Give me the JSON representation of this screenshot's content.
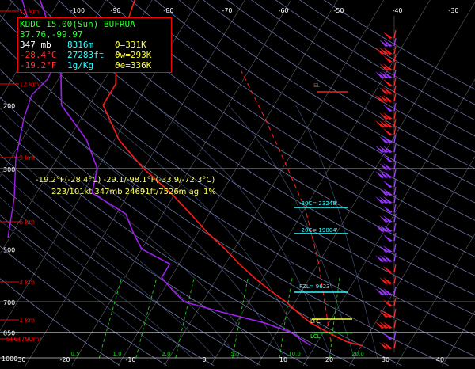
{
  "colors": {
    "background": "#000000",
    "isobar": "#ffffff",
    "isotherm": "#aab0c8",
    "dry_adiabat": "#7e88c4",
    "moist_adiabat": "#5a6fa0",
    "mixing_ratio": "#22cc22",
    "temperature": "#ff1a1a",
    "dewpoint": "#a020f0",
    "parcel": "#ff1a1a",
    "wind_barb_red": "#ff1a1a",
    "wind_barb_purple": "#9933ff",
    "height_label": "#ff0000",
    "info_title": "#33ff33",
    "info_white": "#ffffff",
    "info_cyan": "#33ffff",
    "info_yellow": "#ffff33",
    "info_red": "#ff3333",
    "cursor_text": "#ffff66",
    "level_marker": "#33ffff",
    "lfc_marker": "#ffff33",
    "lcl_marker": "#33ff33"
  },
  "info_box": {
    "title": "KDDC 15.00(Sun) BUFRUA",
    "latlon": "37.76,-99.97",
    "pressure": "347 mb",
    "height_m": "8316m",
    "theta": "ϑ=331K",
    "temp": "-28.4°C",
    "height_ft": "27283ft",
    "theta_w": "ϑw=293K",
    "dewpoint": "-19.2°F",
    "mixing": "1g/Kg",
    "theta_e": "ϑe=336K"
  },
  "cursor_readout": {
    "line1": "-19.2°F(-28.4°C) -29.1/-98.1°F(-33.9/-72.3°C)",
    "line2": "223/101kt  347mb  24691ft/7526m agl   1%"
  },
  "chart_data": {
    "type": "skew-t",
    "temperature_axis_labels": [
      "-100",
      "-90",
      "-80",
      "-70",
      "-60",
      "-50",
      "-40",
      "-30"
    ],
    "bottom_axis_labels": [
      "-30",
      "-20",
      "-10",
      "0",
      "10",
      "20",
      "30",
      "40"
    ],
    "pressure_labels": [
      "200",
      "300",
      "500",
      "700",
      "850",
      "1000"
    ],
    "height_labels": [
      "15 km",
      "12 km",
      "9 km",
      "6 km",
      "3 km",
      "1 km",
      "SFC(790m)"
    ],
    "mixing_ratio_labels": [
      "0.5",
      "1.0",
      "2.0",
      "5.0",
      "10.0",
      "20.0"
    ],
    "levels": [
      {
        "label": "EL"
      },
      {
        "label": "-30C= 23248'"
      },
      {
        "label": "-20C= 19004'"
      },
      {
        "label": "FZL= 9623'"
      },
      {
        "label": "LFC"
      },
      {
        "label": "LCL"
      }
    ],
    "temperature_profile_c": [
      {
        "p": 925,
        "t": 30
      },
      {
        "p": 900,
        "t": 26
      },
      {
        "p": 850,
        "t": 21
      },
      {
        "p": 800,
        "t": 16
      },
      {
        "p": 750,
        "t": 12
      },
      {
        "p": 700,
        "t": 8
      },
      {
        "p": 650,
        "t": 3
      },
      {
        "p": 600,
        "t": -2
      },
      {
        "p": 550,
        "t": -7
      },
      {
        "p": 500,
        "t": -12
      },
      {
        "p": 450,
        "t": -18
      },
      {
        "p": 400,
        "t": -24
      },
      {
        "p": 350,
        "t": -31
      },
      {
        "p": 300,
        "t": -40
      },
      {
        "p": 250,
        "t": -49
      },
      {
        "p": 200,
        "t": -57
      },
      {
        "p": 175,
        "t": -57
      },
      {
        "p": 150,
        "t": -60
      },
      {
        "p": 125,
        "t": -62
      },
      {
        "p": 100,
        "t": -64
      }
    ],
    "dewpoint_profile_c": [
      {
        "p": 925,
        "t": 19
      },
      {
        "p": 900,
        "t": 17
      },
      {
        "p": 850,
        "t": 13
      },
      {
        "p": 800,
        "t": 6
      },
      {
        "p": 750,
        "t": -4
      },
      {
        "p": 700,
        "t": -14
      },
      {
        "p": 650,
        "t": -18
      },
      {
        "p": 600,
        "t": -22
      },
      {
        "p": 550,
        "t": -22
      },
      {
        "p": 500,
        "t": -30
      },
      {
        "p": 450,
        "t": -34
      },
      {
        "p": 400,
        "t": -38
      },
      {
        "p": 350,
        "t": -48
      },
      {
        "p": 300,
        "t": -50
      },
      {
        "p": 250,
        "t": -56
      },
      {
        "p": 200,
        "t": -66
      },
      {
        "p": 150,
        "t": -72
      },
      {
        "p": 100,
        "t": -85
      }
    ]
  }
}
